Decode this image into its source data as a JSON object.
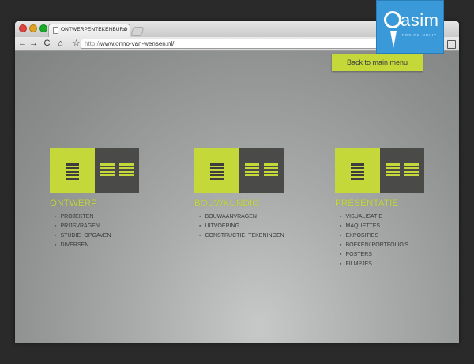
{
  "browser": {
    "tab_title": "ONTWERPENTEKENBURO",
    "tab_close": "×",
    "url_protocol": "http://",
    "url_host": "www.onno-van-wensen.nl/",
    "back_glyph": "←",
    "forward_glyph": "→",
    "reload_glyph": "C",
    "home_glyph": "⌂",
    "star_glyph": "☆",
    "wrench_glyph": "✎"
  },
  "header": {
    "back_button": "Back to main menu"
  },
  "categories": [
    {
      "title": "ONTWERP",
      "items": [
        "PROJEKTEN",
        "PRIJSVRAGEN",
        "STUDIE- OPGAVEN",
        "DIVERSEN"
      ]
    },
    {
      "title": "BOUWKUNDIG",
      "items": [
        "BOUWAANVRAGEN",
        "UITVOERING",
        "CONSTRUCTIE- TEKENINGEN"
      ]
    },
    {
      "title": "PRESENTATIE",
      "items": [
        "VISUALISATIE",
        "MAQUETTES",
        "EXPOSITIES",
        "BOEKEN/ PORTFOLIO'S",
        "POSTERS",
        "FILMPJES"
      ]
    }
  ],
  "badge": {
    "word": "asim",
    "sub": "DESIGN HOLIC"
  },
  "colors": {
    "accent_green": "#c4d83a",
    "tile_dark": "#4a4a49",
    "badge_blue": "#3a9ad9"
  }
}
